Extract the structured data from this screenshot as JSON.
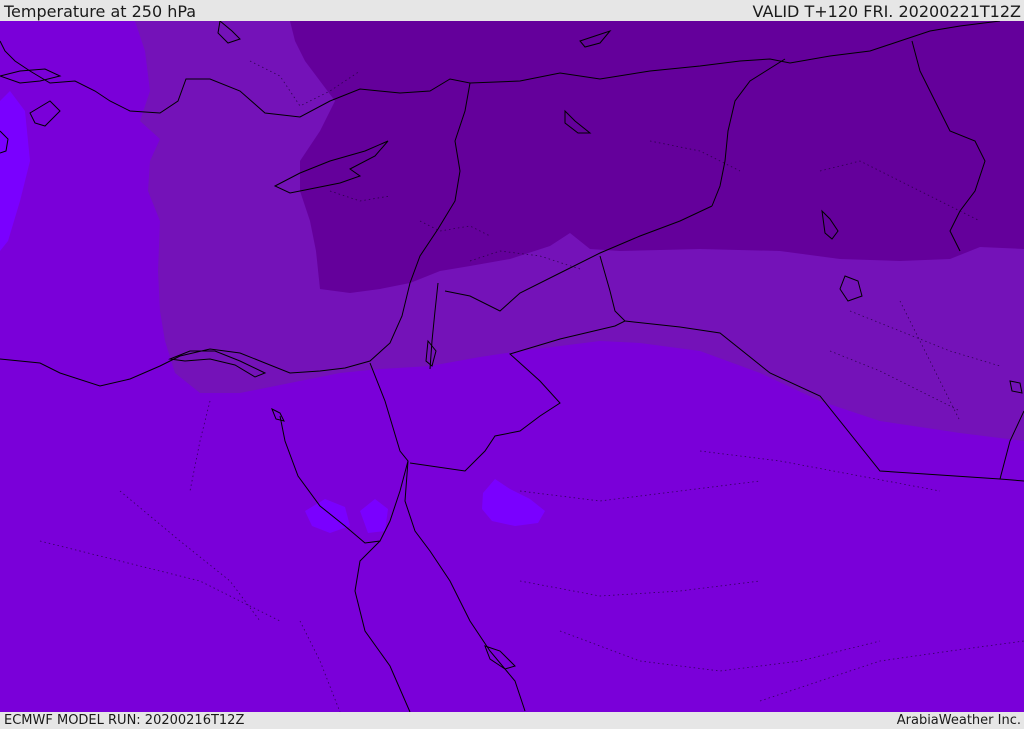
{
  "header": {
    "title": "Temperature at 250 hPa",
    "valid": "VALID T+120 FRI. 20200221T12Z"
  },
  "footer": {
    "model_run": "ECMWF MODEL RUN: 20200216T12Z",
    "credit": "ArabiaWeather Inc."
  },
  "colors": {
    "coldest": "#64009b",
    "cold": "#7412b8",
    "base": "#7a00d9",
    "warm": "#7a00ff",
    "bar_bg": "#e6e6e6",
    "border": "#000000"
  }
}
